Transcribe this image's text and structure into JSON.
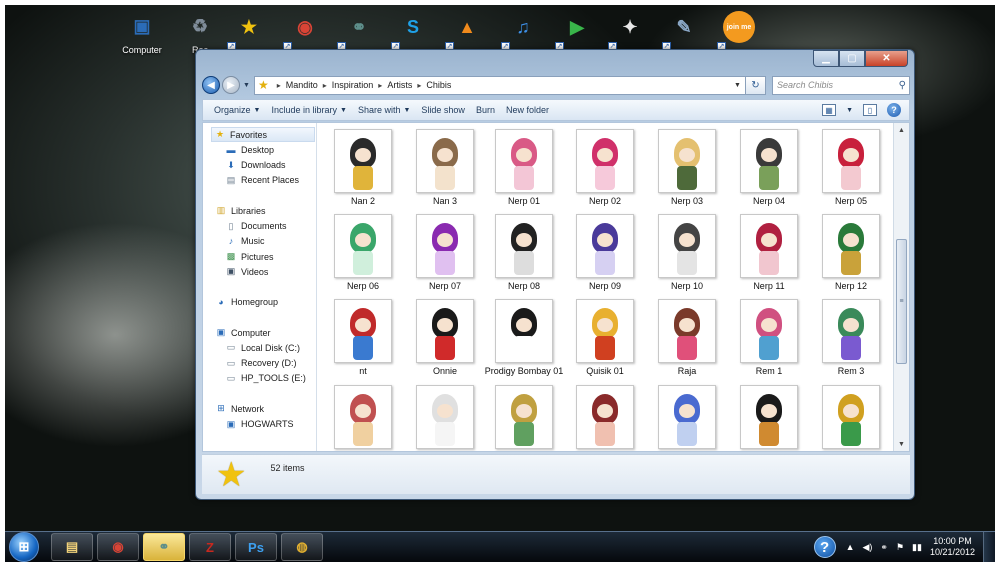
{
  "desktop": {
    "icons": [
      {
        "name": "computer",
        "label": "Computer",
        "glyph": "▣",
        "color": "#2b6cb8"
      },
      {
        "name": "recycle-bin",
        "label": "Rec",
        "glyph": "♻",
        "color": "#7f8c99"
      },
      {
        "name": "favorites-star",
        "label": "",
        "glyph": "★",
        "color": "#f0c20f"
      },
      {
        "name": "chrome",
        "label": "",
        "glyph": "◉",
        "color": "#d94436"
      },
      {
        "name": "network-app",
        "label": "",
        "glyph": "⚭",
        "color": "#5d8e8a"
      },
      {
        "name": "skype",
        "label": "",
        "glyph": "S",
        "color": "#1fa0e6"
      },
      {
        "name": "vlc",
        "label": "",
        "glyph": "▲",
        "color": "#f08a1c"
      },
      {
        "name": "itunes",
        "label": "",
        "glyph": "♫",
        "color": "#3d8fe6"
      },
      {
        "name": "player",
        "label": "",
        "glyph": "▶",
        "color": "#39b54a"
      },
      {
        "name": "alpaca-app",
        "label": "",
        "glyph": "✦",
        "color": "#e7e7e7"
      },
      {
        "name": "paint",
        "label": "",
        "glyph": "✎",
        "color": "#8aa7c6"
      },
      {
        "name": "joinme",
        "label": "",
        "glyph": "join me",
        "color": "#f39a1f"
      }
    ]
  },
  "window": {
    "breadcrumb": [
      "Mandito",
      "Inspiration",
      "Artists",
      "Chibis"
    ],
    "search_placeholder": "Search Chibis",
    "toolbar": [
      {
        "label": "Organize",
        "dropdown": true
      },
      {
        "label": "Include in library",
        "dropdown": true
      },
      {
        "label": "Share with",
        "dropdown": true
      },
      {
        "label": "Slide show",
        "dropdown": false
      },
      {
        "label": "Burn",
        "dropdown": false
      },
      {
        "label": "New folder",
        "dropdown": false
      }
    ],
    "nav": [
      {
        "label": "Favorites",
        "icon": "star-icon",
        "glyph": "★",
        "color": "#e3b10e",
        "indent": 0,
        "selected": true
      },
      {
        "label": "Desktop",
        "icon": "desktop-icon",
        "glyph": "▬",
        "color": "#2b6cb8",
        "indent": 1
      },
      {
        "label": "Downloads",
        "icon": "downloads-icon",
        "glyph": "⬇",
        "color": "#2b6cb8",
        "indent": 1
      },
      {
        "label": "Recent Places",
        "icon": "recent-places-icon",
        "glyph": "▤",
        "color": "#6b7c8c",
        "indent": 1
      },
      {
        "label": "Libraries",
        "icon": "libraries-icon",
        "glyph": "▥",
        "color": "#d1a52c",
        "indent": 0,
        "gap": true
      },
      {
        "label": "Documents",
        "icon": "documents-icon",
        "glyph": "▯",
        "color": "#6b7c8c",
        "indent": 1
      },
      {
        "label": "Music",
        "icon": "music-icon",
        "glyph": "♪",
        "color": "#2b6cb8",
        "indent": 1
      },
      {
        "label": "Pictures",
        "icon": "pictures-icon",
        "glyph": "▩",
        "color": "#3a8f4a",
        "indent": 1
      },
      {
        "label": "Videos",
        "icon": "videos-icon",
        "glyph": "▣",
        "color": "#3e5064",
        "indent": 1
      },
      {
        "label": "Homegroup",
        "icon": "homegroup-icon",
        "glyph": "◕",
        "color": "#2b6cb8",
        "indent": 0,
        "gap": true
      },
      {
        "label": "Computer",
        "icon": "computer-icon",
        "glyph": "▣",
        "color": "#2b6cb8",
        "indent": 0,
        "gap": true
      },
      {
        "label": "Local Disk (C:)",
        "icon": "disk-icon",
        "glyph": "▭",
        "color": "#6b7c8c",
        "indent": 1
      },
      {
        "label": "Recovery (D:)",
        "icon": "disk-icon",
        "glyph": "▭",
        "color": "#6b7c8c",
        "indent": 1
      },
      {
        "label": "HP_TOOLS (E:)",
        "icon": "disk-icon",
        "glyph": "▭",
        "color": "#6b7c8c",
        "indent": 1
      },
      {
        "label": "Network",
        "icon": "network-icon",
        "glyph": "⊞",
        "color": "#2b6cb8",
        "indent": 0,
        "gap": true
      },
      {
        "label": "HOGWARTS",
        "icon": "network-computer-icon",
        "glyph": "▣",
        "color": "#2b6cb8",
        "indent": 1
      }
    ],
    "files": [
      {
        "label": "Nan 2",
        "c1": "#2a2a2a",
        "c2": "#e0b43a"
      },
      {
        "label": "Nan 3",
        "c1": "#8a6a4a",
        "c2": "#f3e2cc"
      },
      {
        "label": "Nerp 01",
        "c1": "#d95a86",
        "c2": "#f3c6d6"
      },
      {
        "label": "Nerp 02",
        "c1": "#d0306a",
        "c2": "#f6c9da"
      },
      {
        "label": "Nerp 03",
        "c1": "#e4c070",
        "c2": "#4e6a3a"
      },
      {
        "label": "Nerp 04",
        "c1": "#3a3a3a",
        "c2": "#7aa05a"
      },
      {
        "label": "Nerp 05",
        "c1": "#c8203c",
        "c2": "#f3c9d0"
      },
      {
        "label": "Nerp 06",
        "c1": "#3aa66a",
        "c2": "#d0efdc"
      },
      {
        "label": "Nerp 07",
        "c1": "#8a2ab0",
        "c2": "#e0c0f0"
      },
      {
        "label": "Nerp 08",
        "c1": "#222222",
        "c2": "#dddddd"
      },
      {
        "label": "Nerp 09",
        "c1": "#4a3a9a",
        "c2": "#d6d0f2"
      },
      {
        "label": "Nerp 10",
        "c1": "#444444",
        "c2": "#e4e4e4"
      },
      {
        "label": "Nerp 11",
        "c1": "#b02040",
        "c2": "#f1c6cf"
      },
      {
        "label": "Nerp 12",
        "c1": "#2a7a3a",
        "c2": "#c9a23a"
      },
      {
        "label": "nt",
        "c1": "#c02a2a",
        "c2": "#3a7ad0"
      },
      {
        "label": "Onnie",
        "c1": "#1a1a1a",
        "c2": "#d02a2a"
      },
      {
        "label": "Prodigy Bombay 01",
        "c1": "#1a1a1a",
        "c2": "#ffffff"
      },
      {
        "label": "Quisik 01",
        "c1": "#e8b030",
        "c2": "#d04020"
      },
      {
        "label": "Raja",
        "c1": "#7a3a2a",
        "c2": "#e0507a"
      },
      {
        "label": "Rem 1",
        "c1": "#d05080",
        "c2": "#50a0d0"
      },
      {
        "label": "Rem 3",
        "c1": "#3a8a5a",
        "c2": "#7a5ad0"
      },
      {
        "label": "",
        "c1": "#c05050",
        "c2": "#f0d0a0"
      },
      {
        "label": "",
        "c1": "#e0e0e0",
        "c2": "#f5f5f5"
      },
      {
        "label": "",
        "c1": "#c0a040",
        "c2": "#60a060"
      },
      {
        "label": "",
        "c1": "#8a2a2a",
        "c2": "#f0c0b0"
      },
      {
        "label": "",
        "c1": "#4a6ad0",
        "c2": "#c0d0f0"
      },
      {
        "label": "",
        "c1": "#1a1a1a",
        "c2": "#d08a30"
      },
      {
        "label": "",
        "c1": "#d0a020",
        "c2": "#3a9a4a"
      }
    ],
    "status": "52 items"
  },
  "taskbar": {
    "apps": [
      {
        "name": "explorer",
        "glyph": "▤",
        "color": "#f1d27a",
        "active": false
      },
      {
        "name": "chrome",
        "glyph": "◉",
        "color": "#d94436",
        "active": false
      },
      {
        "name": "network-app",
        "glyph": "⚭",
        "color": "#5d8e8a",
        "active": true
      },
      {
        "name": "filezilla",
        "glyph": "Z",
        "color": "#c8281e",
        "active": false
      },
      {
        "name": "photoshop",
        "glyph": "Ps",
        "color": "#3da0f0",
        "active": false
      },
      {
        "name": "maps",
        "glyph": "◍",
        "color": "#e2b030",
        "active": false
      }
    ],
    "clock_time": "10:00 PM",
    "clock_date": "10/21/2012"
  }
}
